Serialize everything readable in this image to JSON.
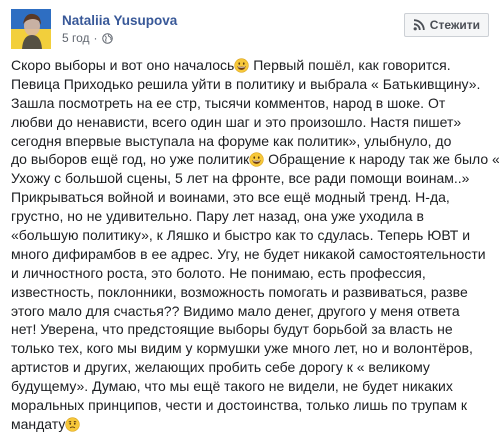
{
  "post": {
    "author": "Nataliia Yusupova",
    "time": "5 год",
    "follow_label": "Стежити",
    "lines": [
      "Скоро выборы и вот оно началось",
      " Первый пошёл, как говорится.",
      "Певица Приходько решила уйти в политику и выбрала « Батькивщину».",
      "Зашла посмотреть на ее стр, тысячи комментов, народ в шоке. От",
      "любви до ненависти, всего один шаг и это произошло. Настя пишет»",
      "сегодня впервые выступала на форуме как политик», улыбнуло, до",
      "до выборов ещё год, но уже политик",
      " Обращение к народу так же было «",
      "Ухожу с большой сцены, 5 лет на фронте, все ради помощи воинам..»",
      "Прикрываться войной и воинами, это все ещё модный тренд. Н-да,",
      "грустно, но не удивительно. Пару лет назад, она уже уходила в",
      "«большую политику», к Ляшко и быстро как то сдулась. Теперь ЮВТ и",
      "много дифирамбов в ее адрес. Угу, не будет никакой самостоятельности",
      "и личностного роста, это болото. Не понимаю, есть профессия,",
      "известность, поклонники, возможность помогать и развиваться, разве",
      "этого мало для счастья?? Видимо мало денег, другого у меня ответа",
      "нет! Уверена, что предстоящие выборы будут борьбой за власть не",
      "только тех, кого мы видим у кормушки уже много лет, но и волонтёров,",
      "артистов и других, желающих пробить себе дорогу к « великому",
      "будущему». Думаю, что мы ещё такого не видели, не будет никаких",
      "моральных принципов, чести и достоинства, только лишь по трупам к",
      "мандату"
    ]
  },
  "icons": {
    "globe": "globe-icon",
    "follow": "rss-icon",
    "grin": "grinning-emoji",
    "sad": "worried-emoji"
  },
  "colors": {
    "author": "#385898",
    "meta": "#616770",
    "text": "#1c1e21"
  }
}
